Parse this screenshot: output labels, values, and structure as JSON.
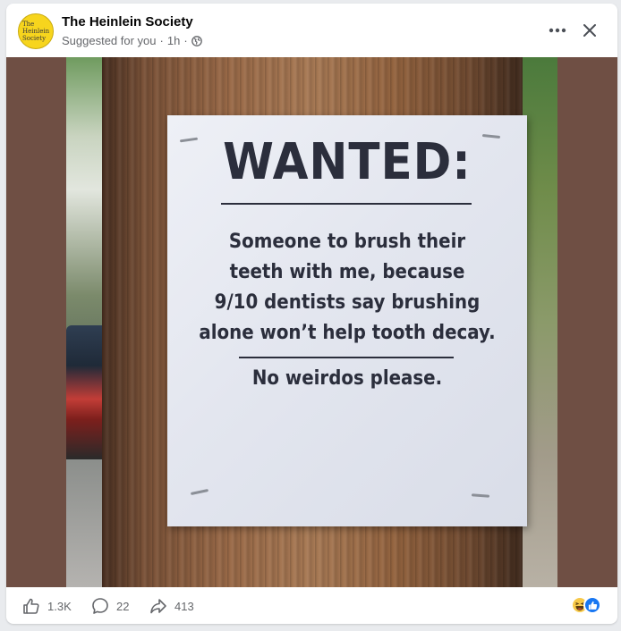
{
  "post": {
    "page_name": "The Heinlein Society",
    "avatar_text": [
      "The",
      "Heinlein",
      "Society"
    ],
    "meta_label": "Suggested for you",
    "meta_sep": "·",
    "time": "1h"
  },
  "poster": {
    "heading": "WANTED:",
    "body_lines": [
      "Someone to brush their",
      "teeth with me, because",
      "9/10 dentists say brushing",
      "alone won’t help tooth decay."
    ],
    "footer": "No weirdos please."
  },
  "actions": {
    "likes": "1.3K",
    "comments": "22",
    "shares": "413"
  },
  "icons": {
    "globe": "globe-icon",
    "more": "more-options-icon",
    "close": "close-icon",
    "like": "thumbs-up-icon",
    "comment": "comment-icon",
    "share": "share-icon"
  },
  "colors": {
    "brand_blue": "#1877f2",
    "avatar_yellow": "#f7d51d",
    "secondary_text": "#65676b"
  }
}
